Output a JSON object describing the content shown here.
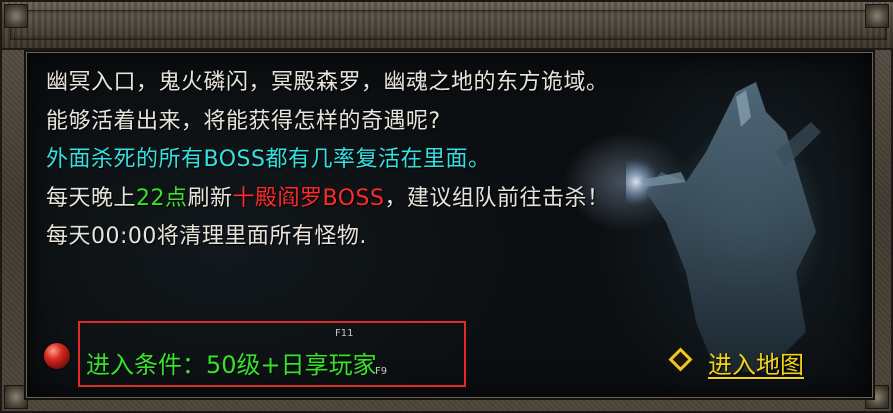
{
  "dialog": {
    "lines": [
      "幽冥入口，鬼火磷闪，冥殿森罗，幽魂之地的东方诡域。",
      "能够活着出来，将能获得怎样的奇遇呢?",
      "外面杀死的所有BOSS都有几率复活在里面。"
    ],
    "line4": {
      "prefix": "每天晚上",
      "time": "22点",
      "middle": "刷新",
      "boss": "十殿阎罗BOSS",
      "suffix": "，建议组队前往击杀！"
    },
    "line5": "每天00:00将清理里面所有怪物."
  },
  "condition": {
    "text": "进入条件：50级+日享玩家",
    "label_top": "F11",
    "label_bottom": "F9"
  },
  "enter_map": {
    "label": "进入地图"
  },
  "colors": {
    "text": "#e8e4dc",
    "cyan": "#35e0e0",
    "green": "#37e22a",
    "red": "#ff2a2a",
    "gold": "#f2d21a",
    "highlight_box": "#e12a2a"
  },
  "icons": {
    "orb": "red-orb-icon",
    "diamond": "gold-diamond-icon"
  }
}
